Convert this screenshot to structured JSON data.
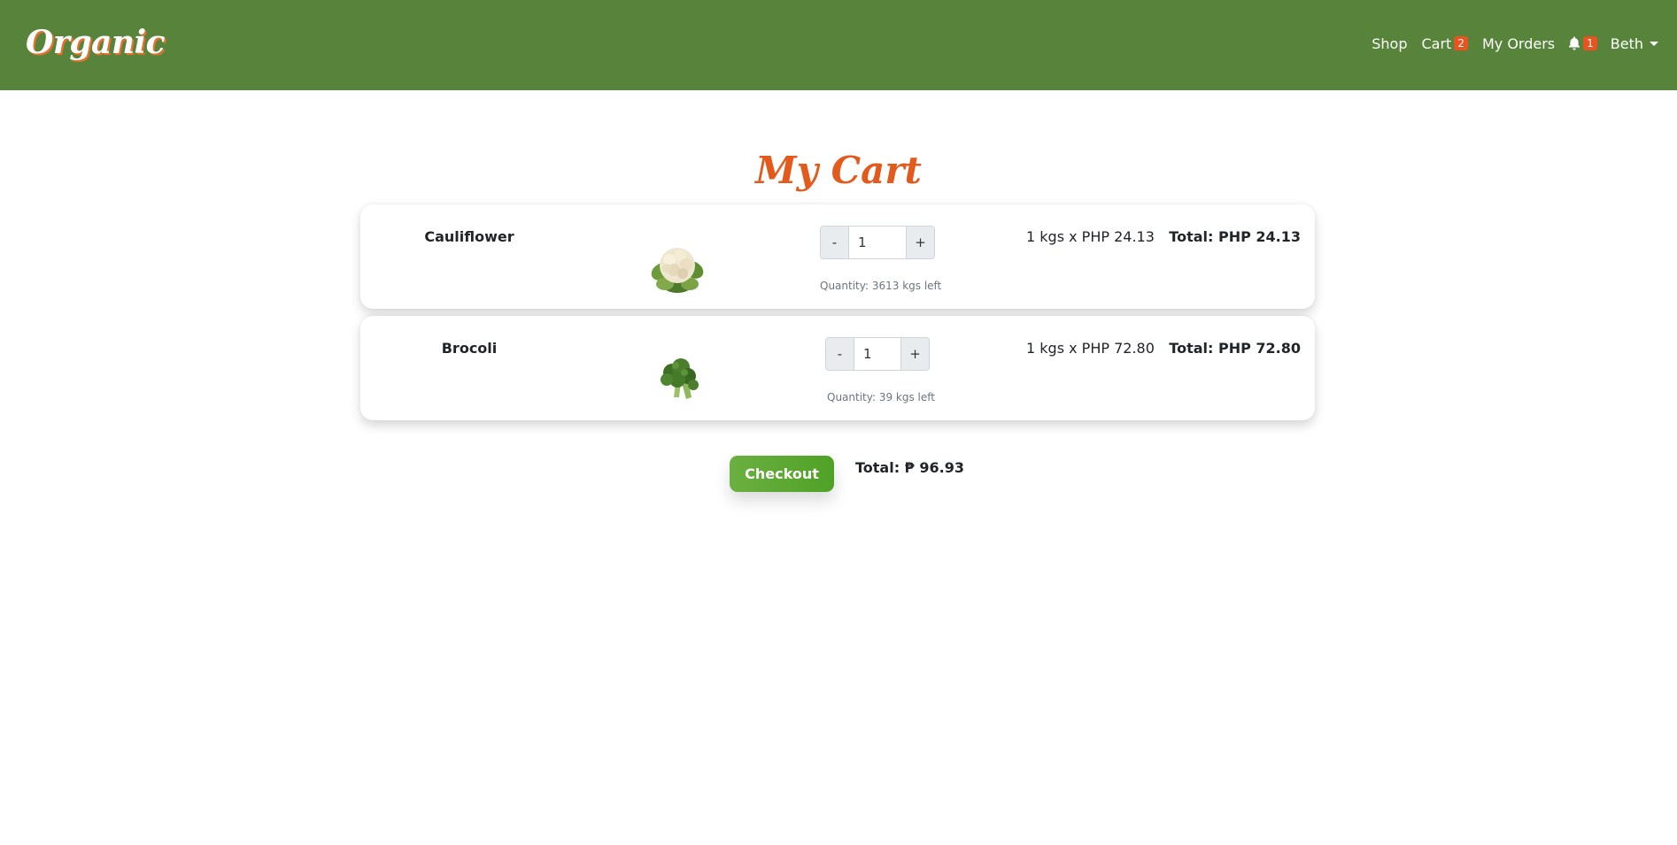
{
  "navbar": {
    "brand": "Organic",
    "shop_label": "Shop",
    "cart_label": "Cart",
    "cart_count": "2",
    "orders_label": "My Orders",
    "notification_count": "1",
    "user_name": "Beth"
  },
  "page": {
    "title": "My Cart"
  },
  "cart": {
    "items": [
      {
        "name": "Cauliflower",
        "image_icon": "cauliflower-image",
        "minus_label": "-",
        "plus_label": "+",
        "quantity": "1",
        "stock_note": "Quantity: 3613 kgs left",
        "unit_price": "1 kgs x PHP 24.13",
        "line_total": "Total: PHP 24.13"
      },
      {
        "name": "Brocoli",
        "image_icon": "broccoli-image",
        "minus_label": "-",
        "plus_label": "+",
        "quantity": "1",
        "stock_note": "Quantity: 39 kgs left",
        "unit_price": "1 kgs x PHP 72.80",
        "line_total": "Total: PHP 72.80"
      }
    ],
    "checkout_label": "Checkout",
    "grand_total": "Total: ₱ 96.93"
  },
  "colors": {
    "navbar_bg": "#57833a",
    "accent_orange": "#e35a1d",
    "badge": "#e8531f",
    "checkout_green": "#5aa830"
  }
}
